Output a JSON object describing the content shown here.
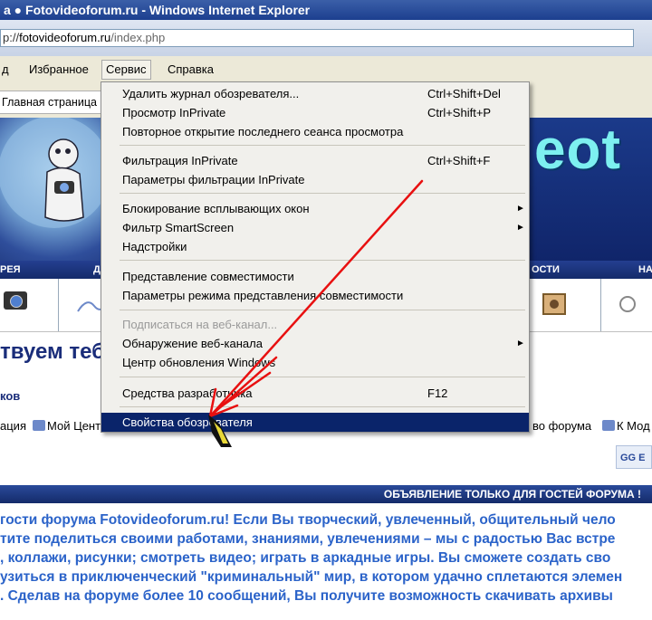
{
  "window": {
    "title": "а ● Fotovideoforum.ru - Windows Internet Explorer"
  },
  "address": {
    "protocol": "p://",
    "host": "fotovideoforum.ru",
    "path": "/index.php"
  },
  "menubar": {
    "items": [
      {
        "label": "д"
      },
      {
        "label": "Избранное"
      },
      {
        "label": "Сервис"
      },
      {
        "label": "Справка"
      }
    ]
  },
  "favorites": {
    "tab_label": "Главная страница"
  },
  "tools_menu": {
    "items": [
      {
        "label": "Удалить журнал обозревателя...",
        "shortcut": "Ctrl+Shift+Del"
      },
      {
        "label": "Просмотр InPrivate",
        "shortcut": "Ctrl+Shift+P"
      },
      {
        "label": "Повторное открытие последнего сеанса просмотра",
        "shortcut": ""
      },
      {
        "label": "Фильтрация InPrivate",
        "shortcut": "Ctrl+Shift+F"
      },
      {
        "label": "Параметры фильтрации InPrivate",
        "shortcut": ""
      },
      {
        "label": "Блокирование всплывающих окон",
        "shortcut": "",
        "submenu": true
      },
      {
        "label": "Фильтр SmartScreen",
        "shortcut": "",
        "submenu": true
      },
      {
        "label": "Надстройки",
        "shortcut": ""
      },
      {
        "label": "Представление совместимости",
        "shortcut": ""
      },
      {
        "label": "Параметры режима представления совместимости",
        "shortcut": ""
      },
      {
        "label": "Подписаться на веб-канал...",
        "shortcut": "",
        "disabled": true
      },
      {
        "label": "Обнаружение веб-канала",
        "shortcut": "",
        "submenu": true
      },
      {
        "label": "Центр обновления Windows",
        "shortcut": ""
      },
      {
        "label": "Средства разработчика",
        "shortcut": "F12"
      },
      {
        "label": "Свойства обозревателя",
        "shortcut": "",
        "selected": true
      }
    ],
    "submenu_arrow": "►"
  },
  "page": {
    "logo_text": "eot",
    "nav_labels": [
      "РЕЯ",
      "Д",
      "ОСТИ",
      "НА"
    ],
    "welcome": "твуем тебя",
    "sub_heading": "ков",
    "links": [
      "ация",
      "Мой Цент",
      "во форума",
      "К Мод"
    ],
    "search_label": "GG E",
    "announcement": "ОБЪЯВЛЕНИЕ ТОЛЬКО ДЛЯ ГОСТЕЙ ФОРУМА !",
    "body_lines": [
      "гости форума Fotovideoforum.ru! Если Вы творческий, увлеченный, общительный чело",
      "тите поделиться своими работами, знаниями, увлечениями – мы с радостью Вас встре",
      ", коллажи, рисунки; смотреть видео; играть в аркадные игры. Вы сможете создать сво",
      "узиться в приключенческий \"криминальный\" мир, в котором удачно сплетаются элемен",
      ". Сделав на форуме более 10 сообщений, Вы получите возможность скачивать архивы"
    ]
  },
  "colors": {
    "annotation_arrow": "#e81010",
    "selected_highlight": "#0a246a",
    "body_text": "#2b63c9"
  }
}
